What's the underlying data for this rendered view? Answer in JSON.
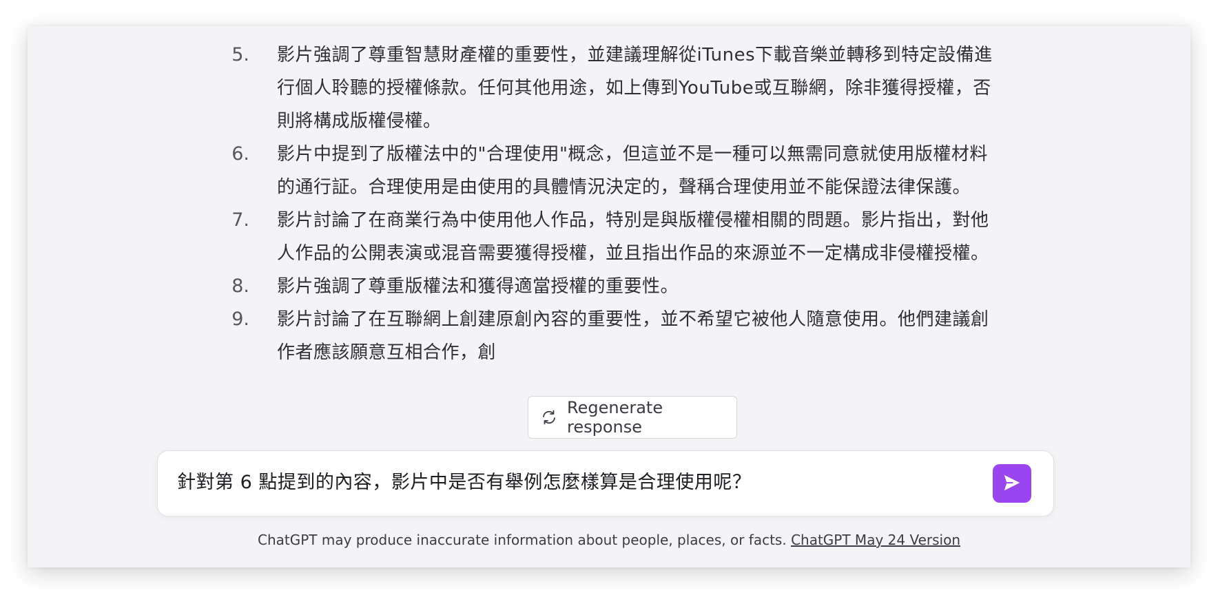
{
  "messages": {
    "partial_top_line": "■■■■■■■■■■■■■■■■■■■■■■■■■■■■■■■■■■■■■",
    "items": [
      {
        "num": "5.",
        "text": "影片強調了尊重智慧財產權的重要性，並建議理解從iTunes下載音樂並轉移到特定設備進行個人聆聽的授權條款。任何其他用途，如上傳到YouTube或互聯網，除非獲得授權，否則將構成版權侵權。"
      },
      {
        "num": "6.",
        "text": "影片中提到了版權法中的\"合理使用\"概念，但這並不是一種可以無需同意就使用版權材料的通行証。合理使用是由使用的具體情況決定的，聲稱合理使用並不能保證法律保護。"
      },
      {
        "num": "7.",
        "text": "影片討論了在商業行為中使用他人作品，特別是與版權侵權相關的問題。影片指出，對他人作品的公開表演或混音需要獲得授權，並且指出作品的來源並不一定構成非侵權授權。"
      },
      {
        "num": "8.",
        "text": "影片強調了尊重版權法和獲得適當授權的重要性。"
      },
      {
        "num": "9.",
        "text": "影片討論了在互聯網上創建原創內容的重要性，並不希望它被他人隨意使用。他們建議創作者應該願意互相合作，創"
      }
    ]
  },
  "regenerate": {
    "label": "Regenerate response",
    "icon": "refresh-icon"
  },
  "composer": {
    "value": "針對第 6 點提到的內容，影片中是否有舉例怎麼樣算是合理使用呢？",
    "send_icon": "send-icon",
    "accent": "#9b45f0"
  },
  "footer": {
    "disclaimer": "ChatGPT may produce inaccurate information about people, places, or facts. ",
    "version_link": "ChatGPT May 24 Version"
  }
}
